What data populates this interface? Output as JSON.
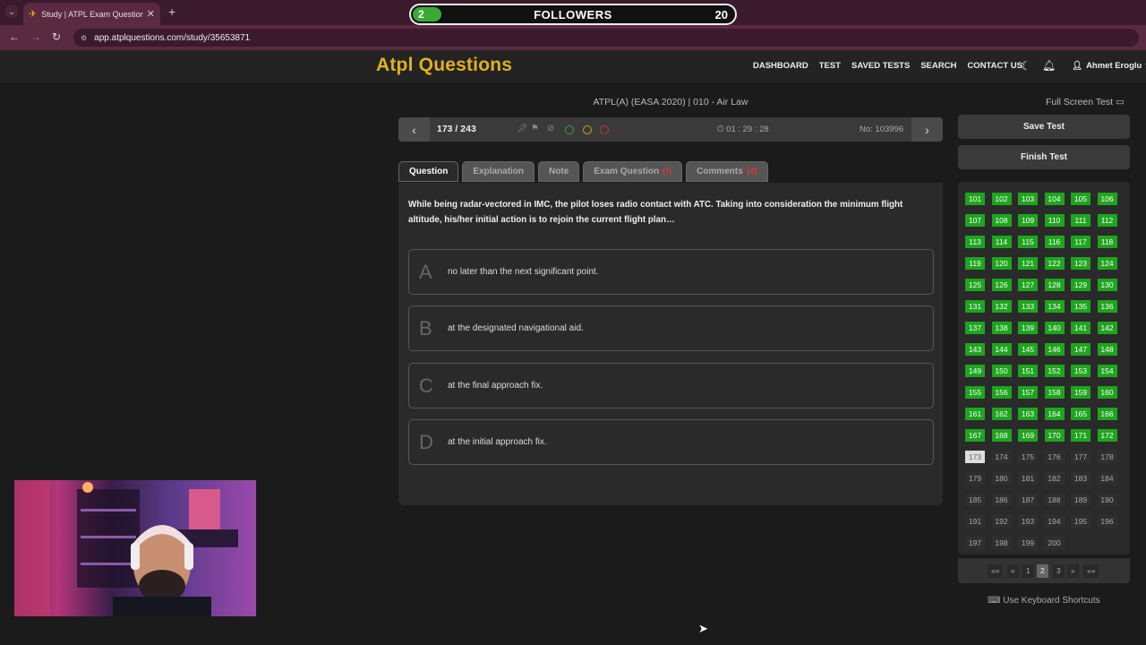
{
  "browser": {
    "tab_title": "Study | ATPL Exam Question Ba",
    "url": "app.atplquestions.com/study/35653871",
    "tab_icon": "airplane-icon"
  },
  "followers_widget": {
    "current": "2",
    "label": "FOLLOWERS",
    "goal": "20",
    "progress_fraction": 0.1,
    "fill_color": "#3aaa35"
  },
  "site": {
    "logo": "Atpl Questions",
    "nav": [
      "DASHBOARD",
      "TEST",
      "SAVED TESTS",
      "SEARCH",
      "CONTACT US"
    ],
    "user_name": "Ahmet Eroglu"
  },
  "exam": {
    "title": "ATPL(A) (EASA 2020) | 010 - Air Law",
    "full_screen_label": "Full Screen Test",
    "counter": "173 / 243",
    "timer": "01 : 29 : 28",
    "question_no": "No: 103996"
  },
  "tabs": [
    {
      "label": "Question",
      "badge": ""
    },
    {
      "label": "Explanation",
      "badge": ""
    },
    {
      "label": "Note",
      "badge": ""
    },
    {
      "label": "Exam Question",
      "badge": "(!)"
    },
    {
      "label": "Comments",
      "badge": "(4)"
    }
  ],
  "question": {
    "text": "While being radar-vectored in IMC, the pilot loses radio contact with ATC. Taking into consideration the minimum flight altitude, his/her initial action is to rejoin the current flight plan…",
    "answers": [
      {
        "letter": "A",
        "text": "no later than the next significant point."
      },
      {
        "letter": "B",
        "text": "at the designated navigational aid."
      },
      {
        "letter": "C",
        "text": "at the final approach fix."
      },
      {
        "letter": "D",
        "text": "at the initial approach fix."
      }
    ]
  },
  "sidebar": {
    "save_label": "Save Test",
    "finish_label": "Finish Test",
    "grid_start": 101,
    "grid_end": 200,
    "answered_through": 172,
    "current": 173,
    "pager": [
      "««",
      "«",
      "1",
      "2",
      "3",
      "»",
      "»»"
    ],
    "pager_active": "2",
    "shortcuts_label": "Use Keyboard Shortcuts"
  },
  "colors": {
    "answered": "#1ea51e",
    "accent_logo": "#e0b020",
    "dot_green": "#3aa33a",
    "dot_yellow": "#d4a017",
    "dot_red": "#c0392b"
  }
}
